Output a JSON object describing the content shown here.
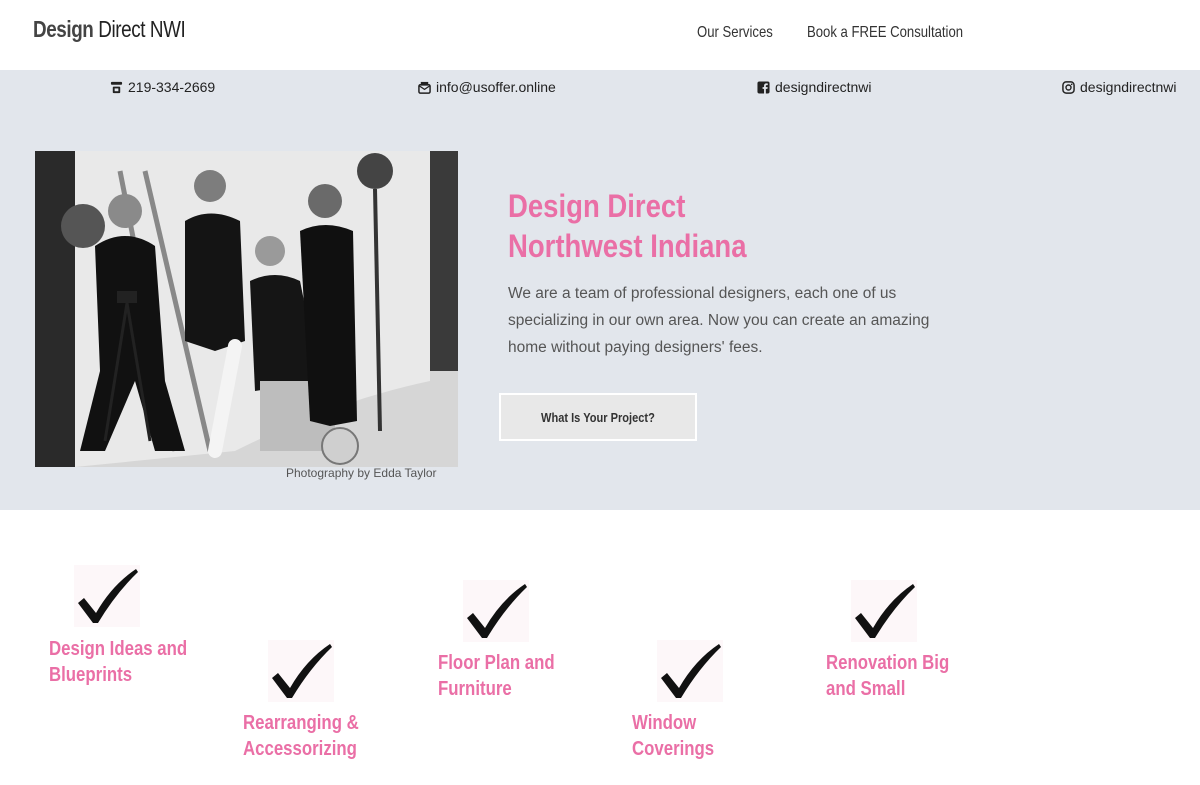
{
  "header": {
    "logo_bold": "Design",
    "logo_rest": " Direct NWI",
    "nav": [
      "Our Services",
      "Book a FREE Consultation"
    ]
  },
  "contact": {
    "phone": "219-334-2669",
    "email": "info@usoffer.online",
    "facebook": "designdirectnwi",
    "instagram": "designdirectnwi"
  },
  "hero": {
    "title_line1": "Design Direct",
    "title_line2": "Northwest Indiana",
    "text": "We are a team of professional designers, each one of us specializing in our own area. Now you can create an amazing home without paying designers' fees.",
    "cta": "What Is Your Project?",
    "photo_caption": "Photography by Edda Taylor"
  },
  "services": [
    {
      "line1": "Design Ideas and",
      "line2": "Blueprints"
    },
    {
      "line1": "Rearranging &",
      "line2": "Accessorizing"
    },
    {
      "line1": "Floor Plan and",
      "line2": "Furniture"
    },
    {
      "line1": "Window",
      "line2": "Coverings"
    },
    {
      "line1": "Renovation Big",
      "line2": "and Small"
    }
  ],
  "colors": {
    "accent_pink": "#ea6fa6",
    "hero_bg": "#e2e6ec"
  },
  "icons": [
    "phone-icon",
    "email-icon",
    "facebook-icon",
    "instagram-icon",
    "checkmark-icon"
  ]
}
